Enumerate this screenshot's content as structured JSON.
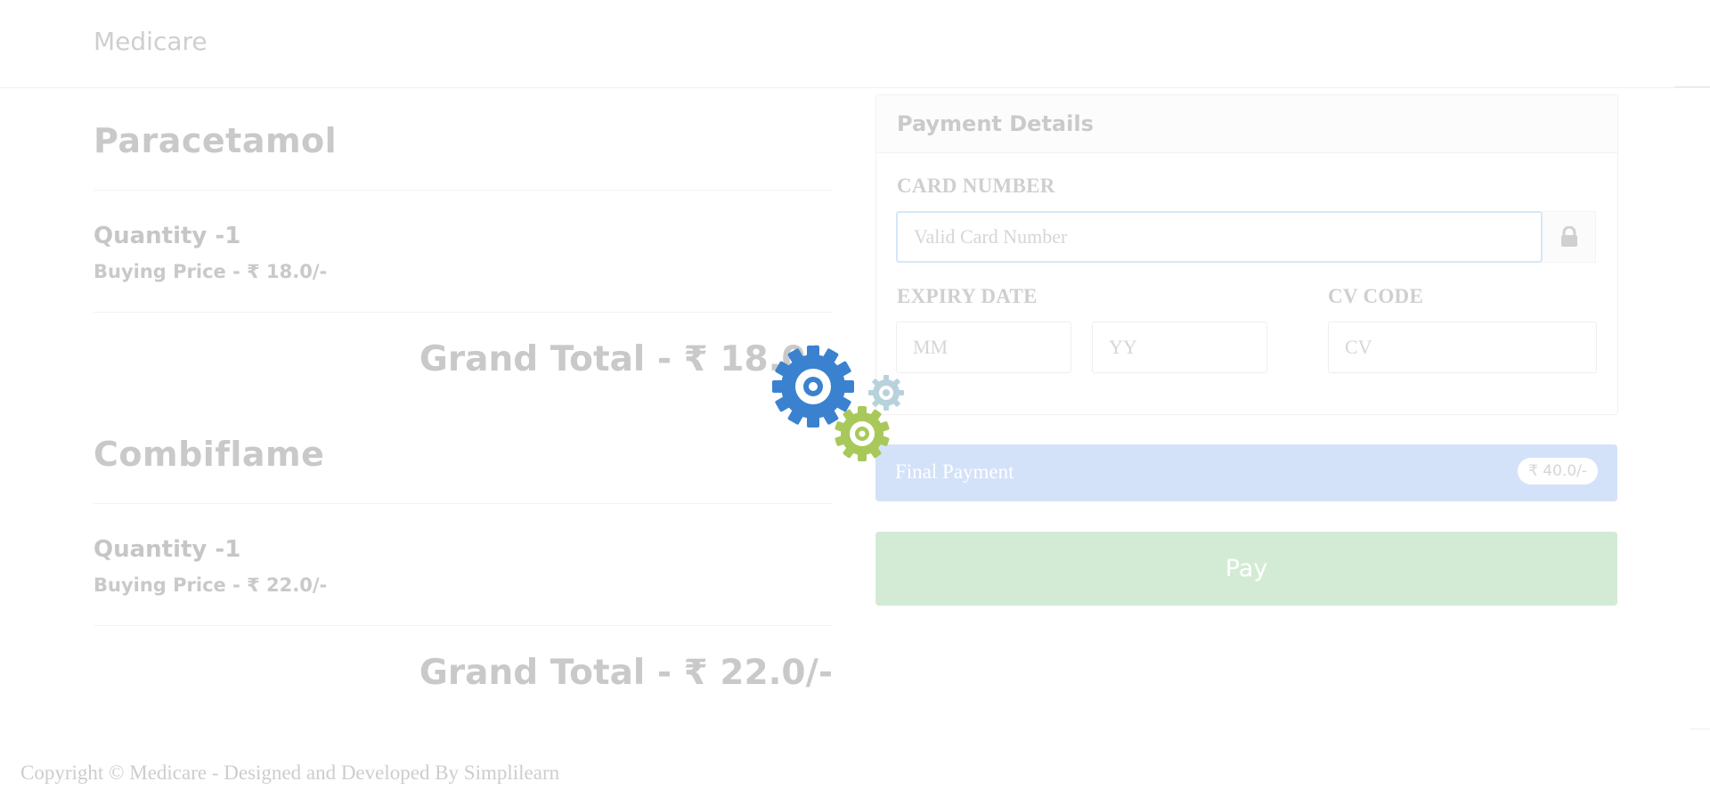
{
  "navbar": {
    "brand": "Medicare"
  },
  "products": [
    {
      "name": "Paracetamol",
      "quantity": "Quantity -1",
      "price": "Buying Price - ₹ 18.0/-",
      "grand_total": "Grand Total - ₹ 18.0/-"
    },
    {
      "name": "Combiflame",
      "quantity": "Quantity -1",
      "price": "Buying Price - ₹ 22.0/-",
      "grand_total": "Grand Total - ₹ 22.0/-"
    }
  ],
  "payment": {
    "title": "Payment Details",
    "card_number_label": "CARD NUMBER",
    "card_number_placeholder": "Valid Card Number",
    "expiry_label": "EXPIRY DATE",
    "month_placeholder": "MM",
    "year_placeholder": "YY",
    "cv_label": "CV CODE",
    "cv_placeholder": "CV",
    "lock_icon": "lock-icon"
  },
  "final_payment": {
    "label": "Final Payment",
    "amount": "₹ 40.0/-"
  },
  "pay_button": {
    "label": "Pay"
  },
  "loading_icon": "gears-loading-icon",
  "footer": {
    "text": "Copyright © Medicare - Designed and Developed By Simplilearn"
  },
  "colors": {
    "final_payment_bg": "#d3e2f8",
    "pay_bg": "#d3ebd4",
    "gear_blue": "#3a82d0",
    "gear_green": "#a8c95a",
    "gear_light": "#b8d2db"
  }
}
